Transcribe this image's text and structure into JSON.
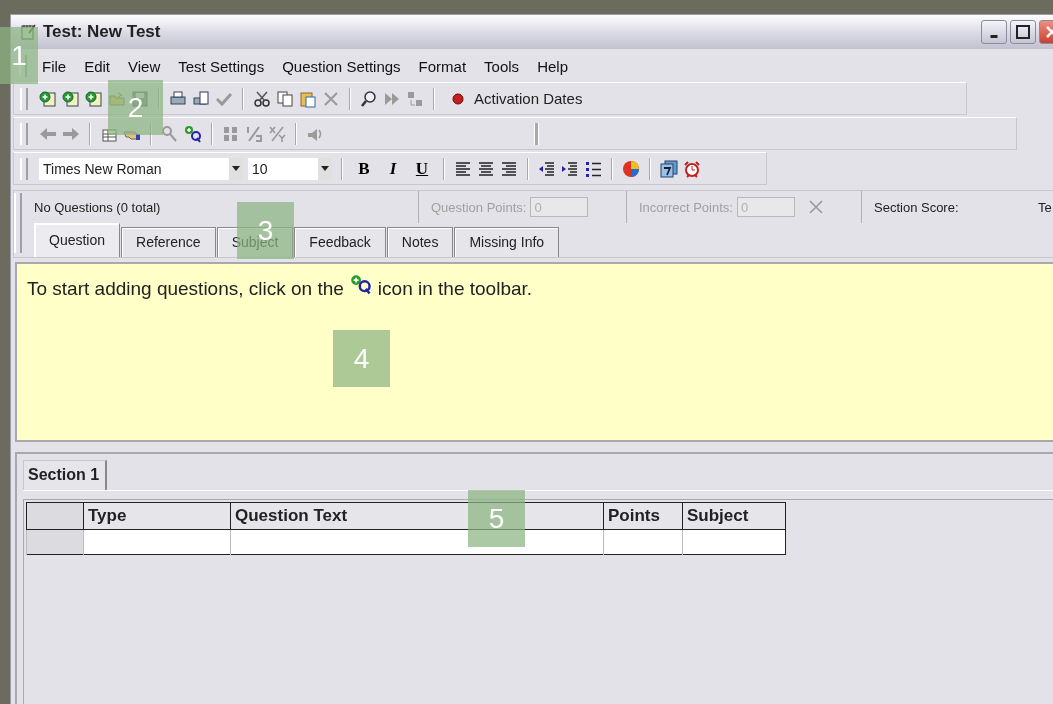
{
  "window": {
    "title": "Test: New Test"
  },
  "menu": [
    "File",
    "Edit",
    "View",
    "Test Settings",
    "Question Settings",
    "Format",
    "Tools",
    "Help"
  ],
  "toolbar": {
    "activation_button": "Activation Dates"
  },
  "format_bar": {
    "font": "Times New Roman",
    "size": "10",
    "styles": [
      "B",
      "I",
      "U"
    ]
  },
  "info": {
    "question_count": "No Questions (0 total)",
    "question_points_label": "Question Points:",
    "question_points": "0",
    "incorrect_points_label": "Incorrect Points:",
    "incorrect_points": "0",
    "section_score_label": "Section Score:",
    "column_cut": "Te",
    "fields_disabled": true
  },
  "tabs": [
    {
      "label": "Question",
      "selected": true
    },
    {
      "label": "Reference",
      "selected": false
    },
    {
      "label": "Subject",
      "selected": false
    },
    {
      "label": "Feedback",
      "selected": false
    },
    {
      "label": "Notes",
      "selected": false
    },
    {
      "label": "Missing Info",
      "selected": false
    }
  ],
  "message": {
    "before": "To start adding questions, click on the",
    "after": "icon in the toolbar."
  },
  "section_tabs": [
    {
      "label": "Section 1",
      "selected": true
    }
  ],
  "table": {
    "columns": [
      "Type",
      "Question Text",
      "Points",
      "Subject"
    ]
  },
  "callouts": [
    "1",
    "2",
    "3",
    "4",
    "5"
  ]
}
